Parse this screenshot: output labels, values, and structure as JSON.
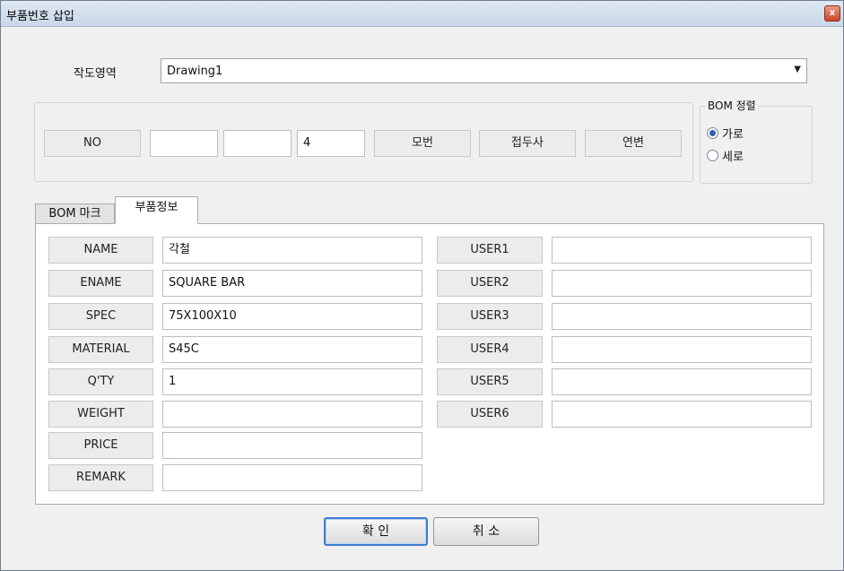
{
  "window": {
    "title": "부품번호 삽입",
    "close_glyph": "x"
  },
  "workspace": {
    "label": "작도영역",
    "value": "Drawing1"
  },
  "numbering": {
    "no_label": "NO",
    "field1": "",
    "field2": "",
    "field3": "4",
    "mobeon_label": "모번",
    "prefix_label": "접두사",
    "yeonbeon_label": "연변"
  },
  "bom_sort": {
    "title": "BOM 정렬",
    "options": [
      {
        "label": "가로",
        "selected": true
      },
      {
        "label": "세로",
        "selected": false
      }
    ]
  },
  "tabs": [
    {
      "label": "BOM 마크",
      "active": false
    },
    {
      "label": "부품정보",
      "active": true
    }
  ],
  "part_info": {
    "left": [
      {
        "label": "NAME",
        "value": "각철"
      },
      {
        "label": "ENAME",
        "value": "SQUARE BAR"
      },
      {
        "label": "SPEC",
        "value": "75X100X10"
      },
      {
        "label": "MATERIAL",
        "value": "S45C"
      },
      {
        "label": "Q'TY",
        "value": "1"
      },
      {
        "label": "WEIGHT",
        "value": ""
      },
      {
        "label": "PRICE",
        "value": ""
      },
      {
        "label": "REMARK",
        "value": ""
      }
    ],
    "right": [
      {
        "label": "USER1",
        "value": ""
      },
      {
        "label": "USER2",
        "value": ""
      },
      {
        "label": "USER3",
        "value": ""
      },
      {
        "label": "USER4",
        "value": ""
      },
      {
        "label": "USER5",
        "value": ""
      },
      {
        "label": "USER6",
        "value": ""
      }
    ]
  },
  "buttons": {
    "ok_label": "확 인",
    "cancel_label": "취 소"
  }
}
